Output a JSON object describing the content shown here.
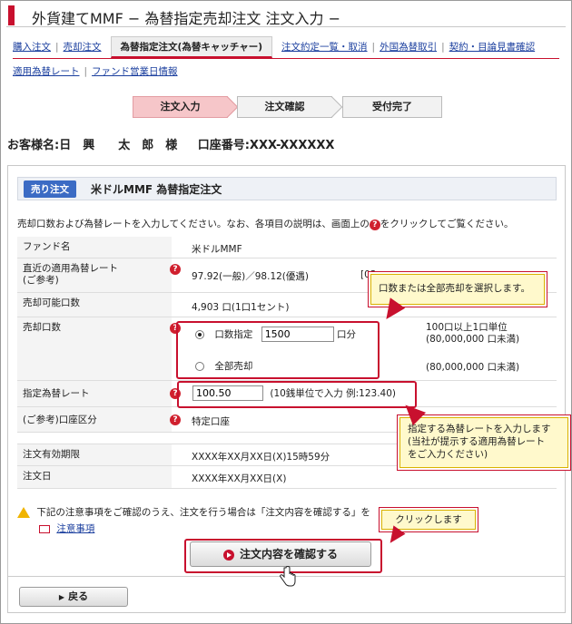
{
  "page": {
    "title": "外貨建てMMF − 為替指定売却注文 注文入力 −"
  },
  "nav": {
    "row1": [
      "購入注文",
      "売却注文",
      "為替指定注文(為替キャッチャー)",
      "注文約定一覧・取消",
      "外国為替取引",
      "契約・目論見書確認"
    ],
    "row2": [
      "適用為替レート",
      "ファンド営業日情報"
    ]
  },
  "steps": [
    "注文入力",
    "注文確認",
    "受付完了"
  ],
  "customer": {
    "name": "お客様名:日　興　　太　郎　様",
    "account": "口座番号:XXX-XXXXXX"
  },
  "panel": {
    "badge": "売り注文",
    "title": "米ドルMMF 為替指定注文",
    "intro_pre": "売却口数および為替レートを入力してください。なお、各項目の説明は、画面上の",
    "intro_post": "をクリックしてご覧ください。",
    "help_mark": "?"
  },
  "rows": {
    "fund": {
      "label": "ファンド名",
      "value": "米ドルMMF"
    },
    "rate": {
      "label": "直近の適用為替レート\n(ご参考)",
      "value": "97.92(一般)／98.12(優遇)",
      "extra": "[03"
    },
    "available": {
      "label": "売却可能口数",
      "value": "4,903 口(1口1セント)"
    },
    "units": {
      "label": "売却口数",
      "opt1": "口数指定",
      "opt1_value": "1500",
      "opt1_unit": "口分",
      "opt2": "全部売却",
      "note1": "100口以上1口単位\n(80,000,000 口未満)",
      "note2": "(80,000,000 口未満)"
    },
    "target_rate": {
      "label": "指定為替レート",
      "value": "100.50",
      "note": "(10銭単位で入力 例:123.40)"
    },
    "account_type": {
      "label": "(ご参考)口座区分",
      "value": "特定口座"
    },
    "expiry": {
      "label": "注文有効期限",
      "value": "XXXX年XX月XX日(X)15時59分"
    },
    "order_date": {
      "label": "注文日",
      "value": "XXXX年XX月XX日(X)"
    }
  },
  "notice": {
    "text": "下記の注意事項をご確認のうえ、注文を行う場合は「注文内容を確認する」を",
    "link": "注意事項"
  },
  "buttons": {
    "confirm": "注文内容を確認する",
    "back": "戻る"
  },
  "callouts": {
    "units": "口数または全部売却を選択します。",
    "rate": "指定する為替レートを入力します\n(当社が提示する適用為替レート\nをご入力ください)",
    "click": "クリックします"
  },
  "colors": {
    "accent": "#c8102e",
    "badge": "#3b6bc4",
    "callout_bg": "#fff9cc"
  }
}
